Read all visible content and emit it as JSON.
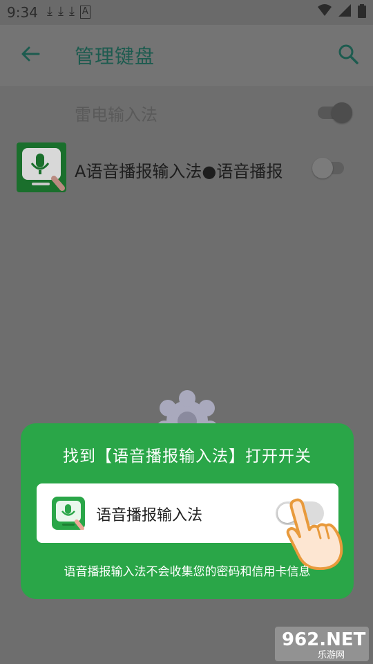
{
  "status": {
    "time": "9:34",
    "left_icons": [
      "download-icon",
      "download-icon",
      "download-icon",
      "a-icon"
    ],
    "right_icons": [
      "wifi-icon",
      "signal-icon",
      "battery-icon"
    ]
  },
  "appbar": {
    "title": "管理键盘",
    "back_icon": "back-arrow-icon",
    "search_icon": "search-icon"
  },
  "list": {
    "items": [
      {
        "label": "雷电输入法",
        "enabled": true
      },
      {
        "label": "A语音播报输入法●语音播报",
        "enabled": false
      }
    ]
  },
  "card": {
    "title": "找到【语音播报输入法】打开开关",
    "item_label": "语音播报输入法",
    "note": "语音播报输入法不会收集您的密码和信用卡信息",
    "bg_color": "#2aa648"
  },
  "watermark": {
    "brand": "962.NET",
    "sub": "乐游网"
  }
}
